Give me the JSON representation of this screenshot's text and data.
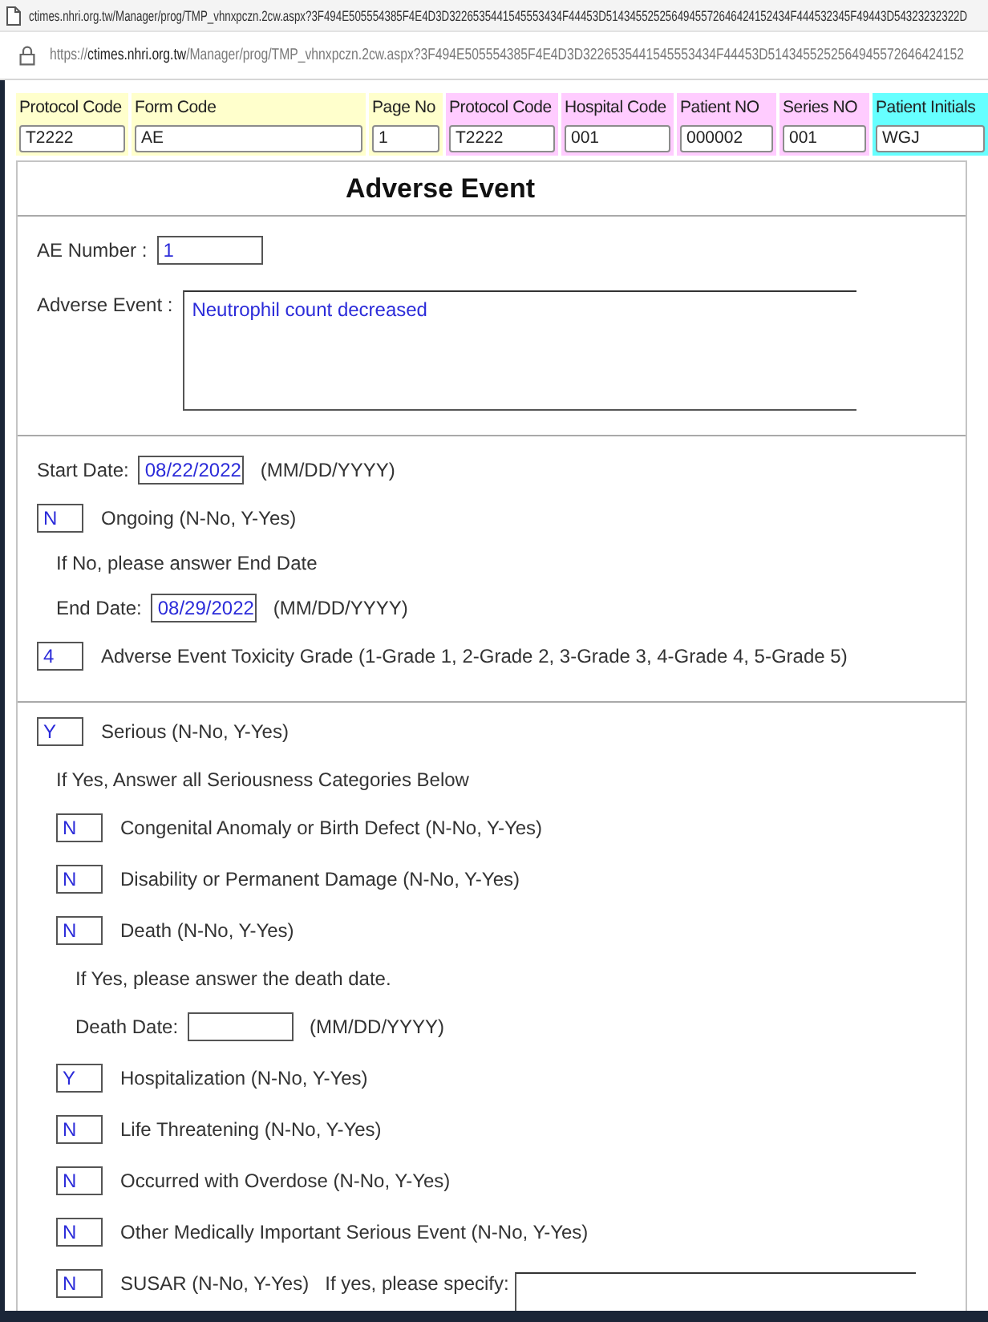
{
  "browser": {
    "title": "ctimes.nhri.org.tw/Manager/prog/TMP_vhnxpczn.2cw.aspx?3F494E505554385F4E4D3D3226535441545553434F44453D5143455252564945572646424152434F444532345F49443D54323232322D",
    "address": {
      "scheme": "https://",
      "host": "ctimes.nhri.org.tw",
      "path": "/Manager/prog/TMP_vhnxpczn.2cw.aspx?3F494E505554385F4E4D3D3226535441545553434F44453D5143455252564945572646424152"
    }
  },
  "header_fields": [
    {
      "label": "Protocol Code",
      "value": "T2222",
      "color": "#ffffcc"
    },
    {
      "label": "Form Code",
      "value": "AE",
      "color": "#ffffcc"
    },
    {
      "label": "Page No",
      "value": "1",
      "color": "#ffffcc"
    },
    {
      "label": "Protocol Code",
      "value": "T2222",
      "color": "#ffccff"
    },
    {
      "label": "Hospital Code",
      "value": "001",
      "color": "#ffccff"
    },
    {
      "label": "Patient NO",
      "value": "000002",
      "color": "#ffccff"
    },
    {
      "label": "Series NO",
      "value": "001",
      "color": "#ffccff"
    },
    {
      "label": "Patient Initials",
      "value": "WGJ",
      "color": "#66ffff"
    }
  ],
  "form": {
    "title": "Adverse Event",
    "sections": [
      {
        "rows": [
          {
            "kind": "field",
            "label": "AE Number :",
            "value": "1"
          },
          {
            "kind": "textarea",
            "label": "Adverse Event :",
            "value": "Neutrophil count decreased"
          }
        ]
      },
      {
        "rows": [
          {
            "kind": "field",
            "label": "Start Date:",
            "value": "08/22/2022",
            "hint": "(MM/DD/YYYY)"
          },
          {
            "kind": "code",
            "value": "N",
            "label": "Ongoing (N-No, Y-Yes)",
            "children": [
              {
                "kind": "note",
                "text": "If No, please answer End Date"
              },
              {
                "kind": "field",
                "label": "End Date:",
                "value": "08/29/2022",
                "hint": "(MM/DD/YYYY)"
              }
            ]
          },
          {
            "kind": "code",
            "value": "4",
            "label": "Adverse Event Toxicity Grade (1-Grade 1, 2-Grade 2, 3-Grade 3, 4-Grade 4, 5-Grade 5)"
          }
        ]
      },
      {
        "rows": [
          {
            "kind": "code",
            "value": "Y",
            "label": "Serious (N-No, Y-Yes)",
            "children": [
              {
                "kind": "note",
                "text": "If Yes, Answer all Seriousness Categories Below"
              },
              {
                "kind": "code",
                "value": "N",
                "label": "Congenital Anomaly or Birth Defect (N-No, Y-Yes)"
              },
              {
                "kind": "code",
                "value": "N",
                "label": "Disability or Permanent Damage (N-No, Y-Yes)"
              },
              {
                "kind": "code",
                "value": "N",
                "label": "Death (N-No, Y-Yes)",
                "children": [
                  {
                    "kind": "note",
                    "text": "If Yes, please answer the death date."
                  },
                  {
                    "kind": "field",
                    "label": "Death Date:",
                    "hint": "(MM/DD/YYYY)"
                  }
                ]
              },
              {
                "kind": "code",
                "value": "Y",
                "label": "Hospitalization (N-No, Y-Yes)"
              },
              {
                "kind": "code",
                "value": "N",
                "label": "Life Threatening (N-No, Y-Yes)"
              },
              {
                "kind": "code",
                "value": "N",
                "label": "Occurred with Overdose (N-No, Y-Yes)"
              },
              {
                "kind": "code",
                "value": "N",
                "label": "Other Medically Important Serious Event (N-No, Y-Yes)"
              },
              {
                "kind": "code",
                "value": "N",
                "label": "SUSAR (N-No, Y-Yes)",
                "specify_label": "If yes, please specify:"
              }
            ]
          }
        ]
      }
    ]
  }
}
